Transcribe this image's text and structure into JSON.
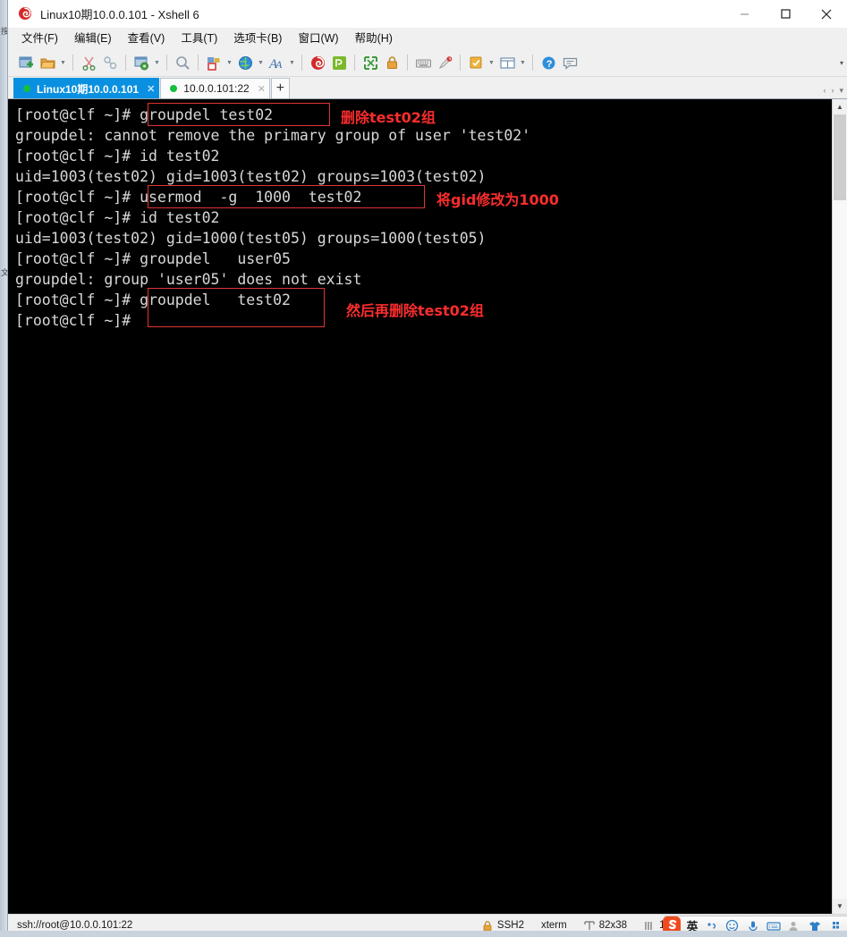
{
  "window": {
    "title": "Linux10期10.0.0.101 - Xshell 6",
    "app_icon": "xshell-icon",
    "minimize_label": "–",
    "maximize_label": "☐",
    "close_label": "✕"
  },
  "menubar": {
    "items": [
      {
        "label": "文件(F)",
        "name": "menu-file"
      },
      {
        "label": "编辑(E)",
        "name": "menu-edit"
      },
      {
        "label": "查看(V)",
        "name": "menu-view"
      },
      {
        "label": "工具(T)",
        "name": "menu-tools"
      },
      {
        "label": "选项卡(B)",
        "name": "menu-tab"
      },
      {
        "label": "窗口(W)",
        "name": "menu-window"
      },
      {
        "label": "帮助(H)",
        "name": "menu-help"
      }
    ]
  },
  "toolbar": {
    "overflow_label": "▾",
    "items": [
      "new-session-icon",
      "open-folder-icon",
      "caret-down-icon",
      "separator",
      "cut-icon",
      "copy-icon",
      "separator",
      "session-properties-icon",
      "caret-down-icon",
      "separator",
      "find-icon",
      "separator",
      "transfer-file-icon",
      "caret-down-icon",
      "globe-icon",
      "caret-down-icon",
      "font-icon",
      "caret-down-icon",
      "separator",
      "xshell-icon",
      "xftp-icon",
      "separator",
      "fullscreen-icon",
      "lock-icon",
      "separator",
      "keyboard-icon",
      "highlight-icon",
      "separator",
      "compose-icon",
      "caret-down-icon",
      "layout-icon",
      "caret-down-icon",
      "separator",
      "help-icon",
      "chat-icon"
    ]
  },
  "tabs": {
    "add_label": "+",
    "nav_prev": "‹",
    "nav_next": "›",
    "nav_menu": "▾",
    "close_label": "✕",
    "items": [
      {
        "label": "Linux10期10.0.0.101",
        "active": true,
        "status": "connected"
      },
      {
        "label": "10.0.0.101:22",
        "active": false,
        "status": "connected"
      }
    ]
  },
  "terminal": {
    "lines": [
      "[root@clf ~]# groupdel test02",
      "groupdel: cannot remove the primary group of user 'test02'",
      "[root@clf ~]# id test02",
      "uid=1003(test02) gid=1003(test02) groups=1003(test02)",
      "[root@clf ~]# usermod  -g  1000  test02",
      "[root@clf ~]# id test02",
      "uid=1003(test02) gid=1000(test05) groups=1000(test05)",
      "[root@clf ~]# groupdel   user05",
      "groupdel: group 'user05' does not exist",
      "[root@clf ~]# groupdel   test02",
      "[root@clf ~]# "
    ],
    "annotations": [
      {
        "text": "删除test02组",
        "name": "annotation-delete-test02-group"
      },
      {
        "text": "将gid修改为1000",
        "name": "annotation-change-gid-1000"
      },
      {
        "text": "然后再删除test02组",
        "name": "annotation-then-delete-test02-group"
      }
    ],
    "colors": {
      "background": "#000000",
      "foreground": "#d8d8d8",
      "annotation": "#fc2d2d",
      "highlight_box": "#e03434"
    }
  },
  "statusbar": {
    "connection": "ssh://root@10.0.0.101:22",
    "protocol": "SSH2",
    "terminal_type": "xterm",
    "size": "82x38",
    "cursor": "11,15",
    "lock_icon": "lock-icon",
    "size_icon": "resize-icon",
    "cursor_icon": "cursor-icon"
  },
  "ime": {
    "logo": "sogou-logo-icon",
    "mode_label": "英",
    "buttons": [
      "punctuation-icon",
      "emoji-icon",
      "voice-icon",
      "keyboard-icon",
      "user-icon",
      "skin-icon",
      "menu-icon"
    ]
  },
  "background_strip": {
    "text_top": "搜",
    "text_mid": "文"
  }
}
